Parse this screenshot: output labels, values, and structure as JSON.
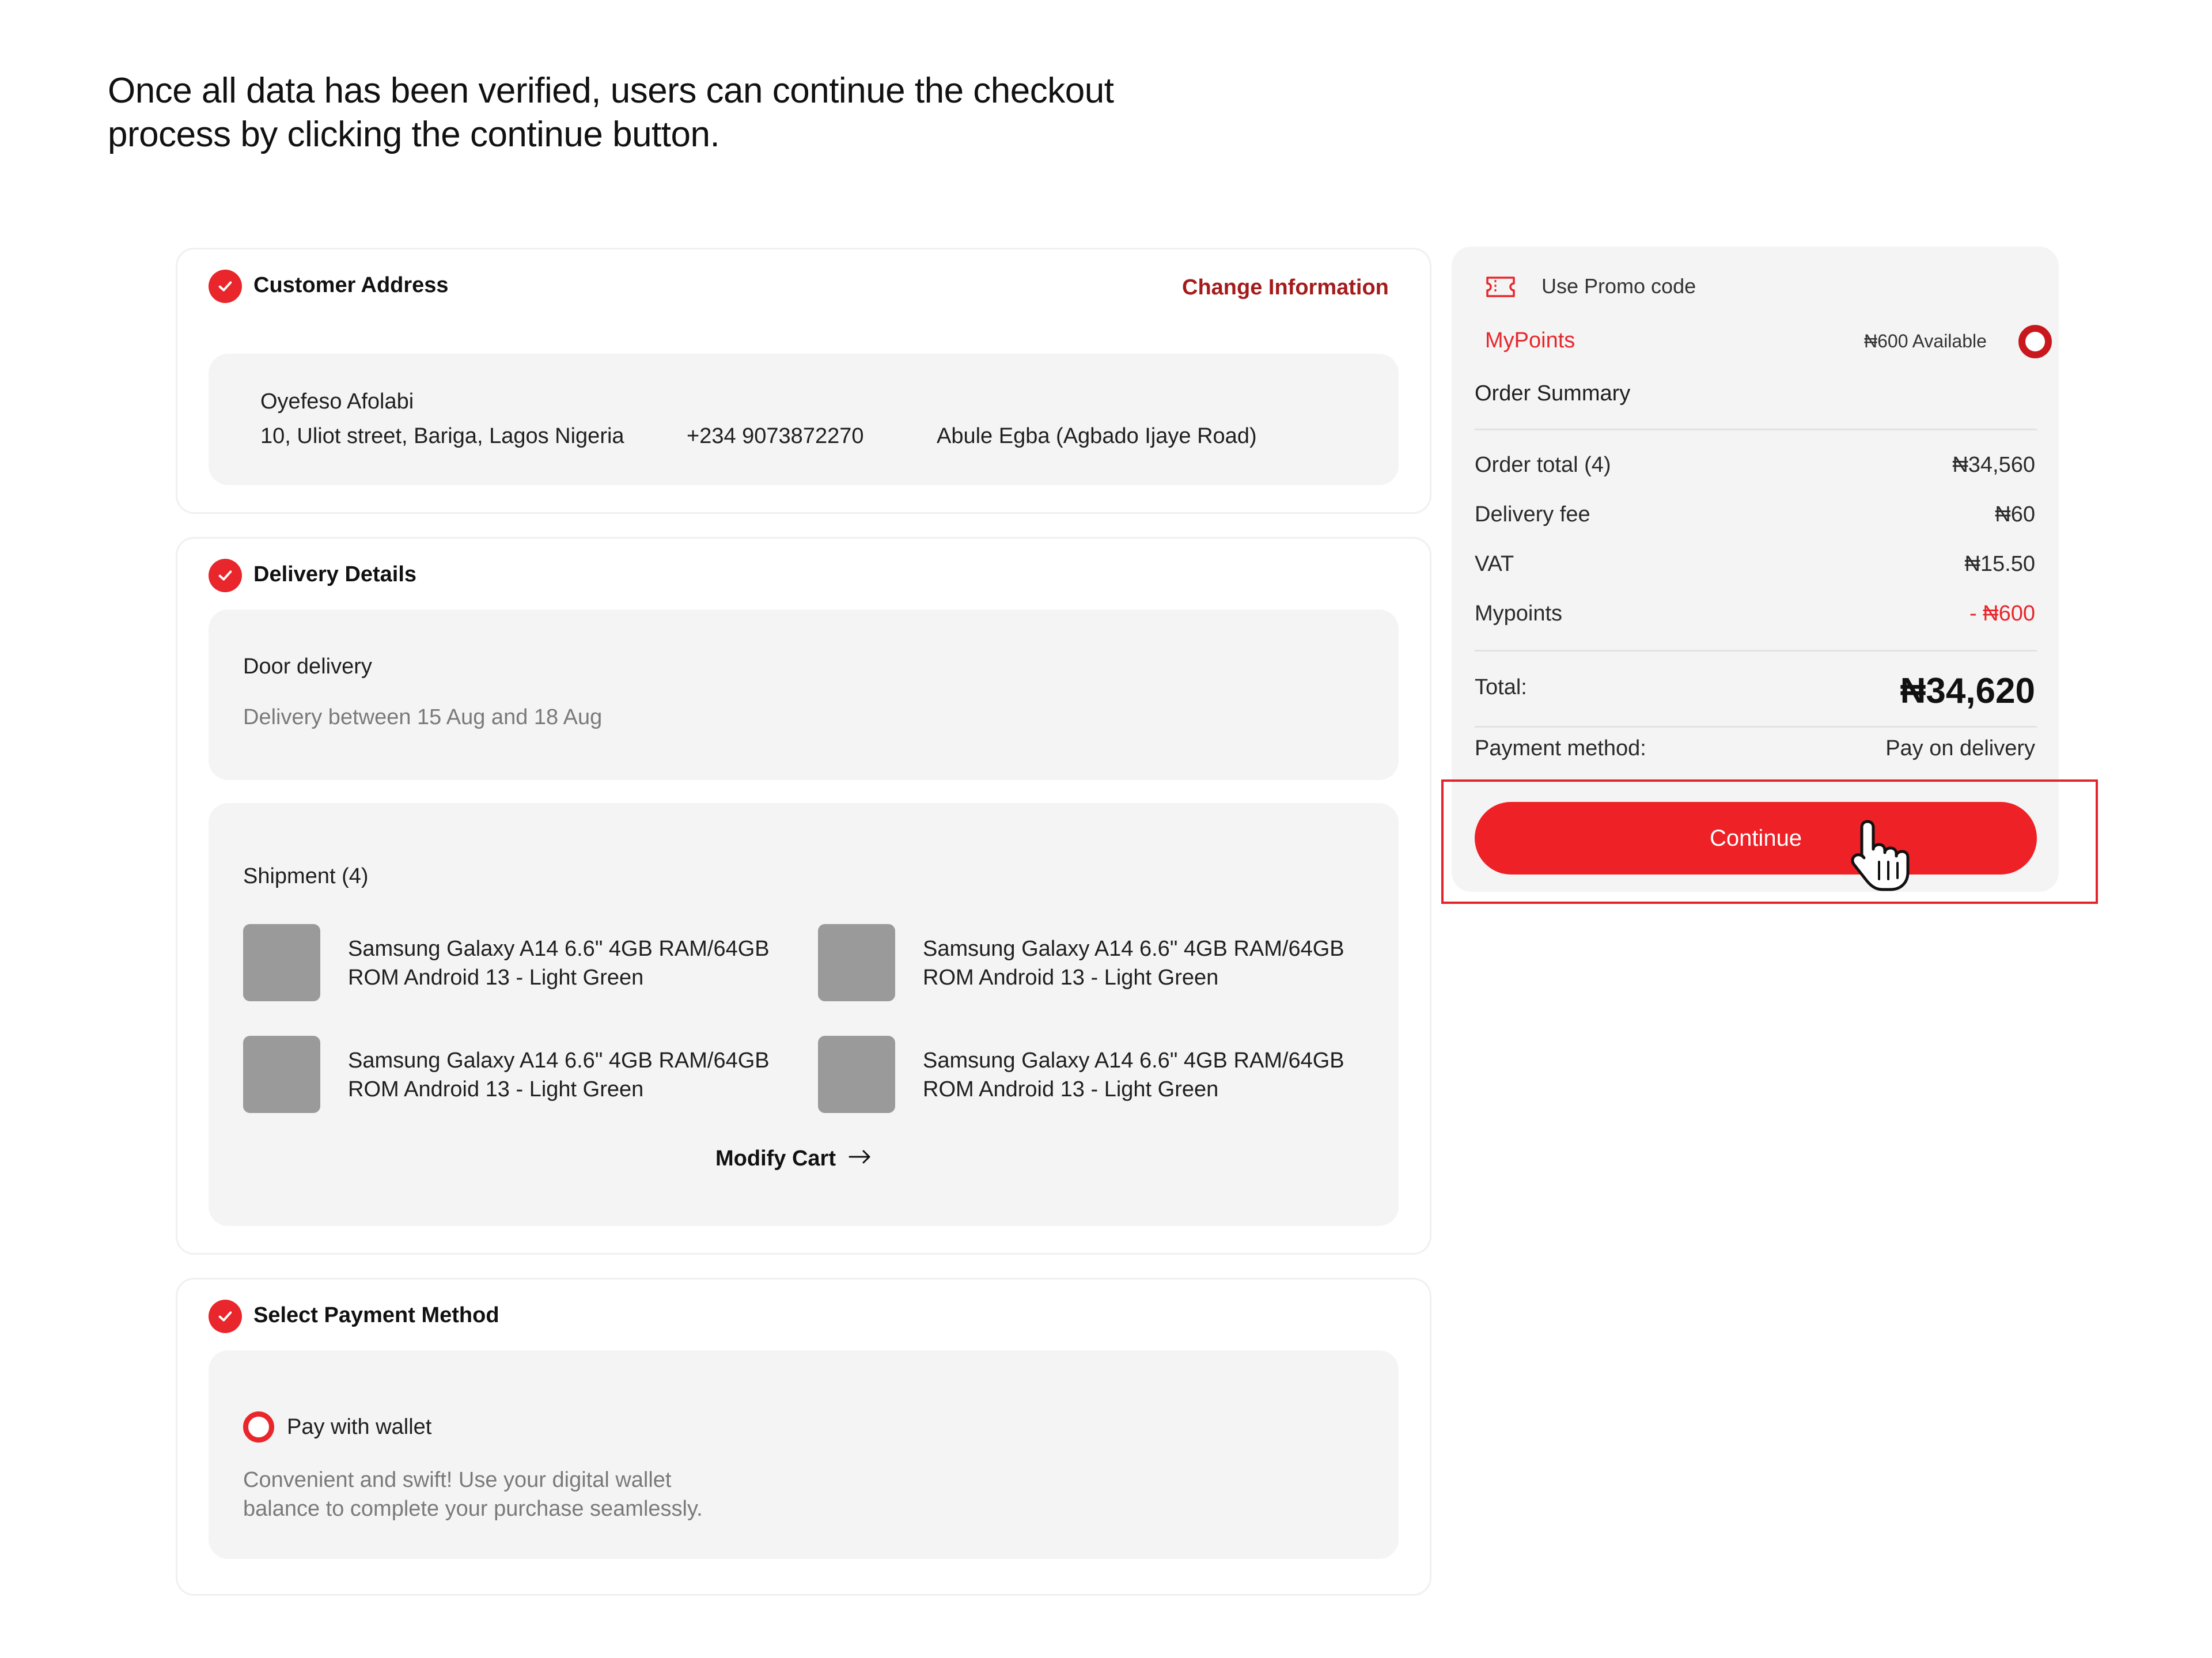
{
  "caption": "Once all data has been verified, users can continue the checkout process by clicking the continue button.",
  "address": {
    "title": "Customer Address",
    "change_link": "Change Information",
    "name": "Oyefeso Afolabi",
    "street": "10, Uliot street, Bariga, Lagos Nigeria",
    "phone": "+234 9073872270",
    "region": "Abule Egba (Agbado Ijaye Road)"
  },
  "delivery": {
    "title": "Delivery Details",
    "method": "Door delivery",
    "window": "Delivery between 15 Aug and 18 Aug",
    "shipment_label": "Shipment (4)",
    "items": [
      {
        "name": "Samsung Galaxy A14 6.6\" 4GB RAM/64GB ROM Android 13 - Light Green"
      },
      {
        "name": "Samsung Galaxy A14 6.6\" 4GB RAM/64GB ROM Android 13 - Light Green"
      },
      {
        "name": "Samsung Galaxy A14 6.6\" 4GB RAM/64GB ROM Android 13 - Light Green"
      },
      {
        "name": "Samsung Galaxy A14 6.6\" 4GB RAM/64GB ROM Android 13 - Light Green"
      }
    ],
    "modify_label": "Modify Cart"
  },
  "payment": {
    "title": "Select Payment Method",
    "option_label": "Pay with wallet",
    "option_desc_line1": "Convenient and swift! Use your digital wallet",
    "option_desc_line2": "balance to complete your purchase seamlessly."
  },
  "summary": {
    "promo_label": "Use Promo code",
    "mypoints_label": "MyPoints",
    "mypoints_available": "₦600 Available",
    "heading": "Order Summary",
    "rows": [
      {
        "label": "Order total (4)",
        "value": "₦34,560"
      },
      {
        "label": "Delivery fee",
        "value": "₦60"
      },
      {
        "label": "VAT",
        "value": "₦15.50"
      },
      {
        "label": "Mypoints",
        "value": "- ₦600"
      }
    ],
    "total_label": "Total:",
    "total_value": "₦34,620",
    "payment_method_label": "Payment method:",
    "payment_method_value": "Pay on delivery",
    "continue_label": "Continue"
  },
  "colors": {
    "accent": "#ee2126",
    "accent_dark": "#a51b1b",
    "panel_bg": "#f4f4f4"
  }
}
